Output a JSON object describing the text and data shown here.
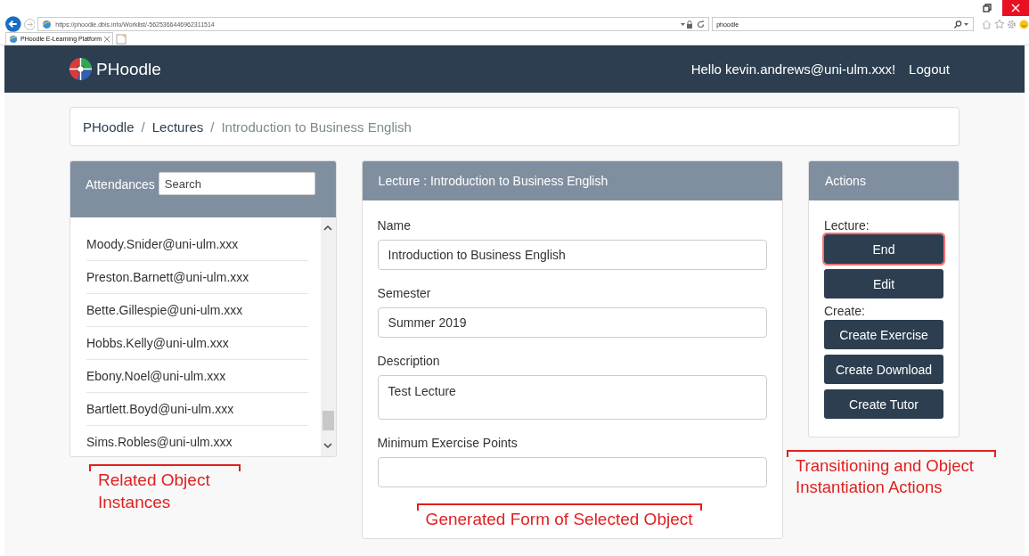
{
  "browser": {
    "url": "https://phoodle.dbis.info/Worklist/-5625366446962311514",
    "search": "phoodle",
    "tab_title": "PHoodle E-Learning Platform"
  },
  "navbar": {
    "brand": "PHoodle",
    "greeting": "Hello kevin.andrews@uni-ulm.xxx!",
    "logout": "Logout"
  },
  "breadcrumb": {
    "separator": "/",
    "items": [
      {
        "label": "PHoodle",
        "current": false
      },
      {
        "label": "Lectures",
        "current": false
      },
      {
        "label": "Introduction to Business English",
        "current": true
      }
    ]
  },
  "attendances": {
    "title": "Attendances",
    "search_placeholder": "Search",
    "items": [
      "Moody.Snider@uni-ulm.xxx",
      "Preston.Barnett@uni-ulm.xxx",
      "Bette.Gillespie@uni-ulm.xxx",
      "Hobbs.Kelly@uni-ulm.xxx",
      "Ebony.Noel@uni-ulm.xxx",
      "Bartlett.Boyd@uni-ulm.xxx",
      "Sims.Robles@uni-ulm.xxx"
    ]
  },
  "form": {
    "title": "Lecture : Introduction to Business English",
    "fields": [
      {
        "label": "Name",
        "value": "Introduction to Business English",
        "kind": "text"
      },
      {
        "label": "Semester",
        "value": "Summer 2019",
        "kind": "text"
      },
      {
        "label": "Description",
        "value": "Test Lecture",
        "kind": "textarea"
      },
      {
        "label": "Minimum Exercise Points",
        "kind": "text"
      }
    ]
  },
  "actions": {
    "title": "Actions",
    "groups": [
      {
        "label": "Lecture:",
        "buttons": [
          {
            "label": "End",
            "focused": true
          },
          {
            "label": "Edit",
            "focused": false
          }
        ]
      },
      {
        "label": "Create:",
        "buttons": [
          {
            "label": "Create Exercise",
            "focused": false
          },
          {
            "label": "Create Download",
            "focused": false
          },
          {
            "label": "Create Tutor",
            "focused": false
          }
        ]
      }
    ]
  },
  "annotations": [
    "Related Object Instances",
    "Generated Form of Selected Object",
    "Transitioning and Object Instantiation Actions"
  ]
}
